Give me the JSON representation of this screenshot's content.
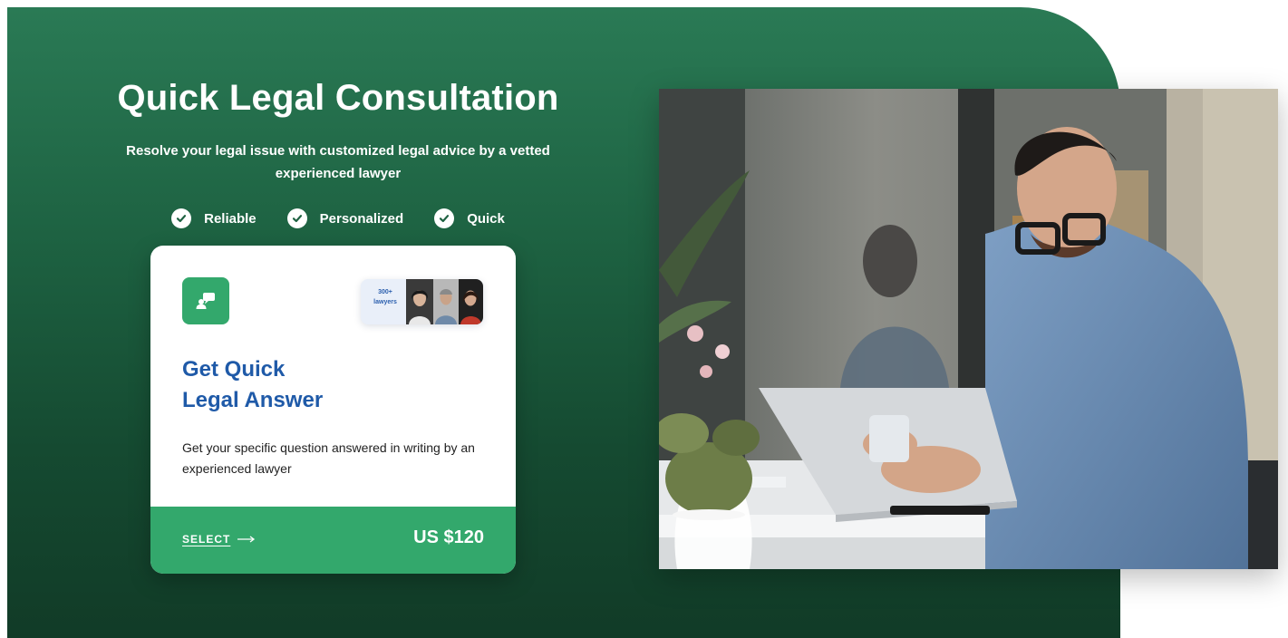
{
  "hero": {
    "title": "Quick Legal Consultation",
    "subtitle": "Resolve your legal issue with customized legal advice by a vetted experienced lawyer",
    "features": [
      "Reliable",
      "Personalized",
      "Quick"
    ]
  },
  "card": {
    "lawyers_count": "300+",
    "lawyers_label": "lawyers",
    "title_line1": "Get Quick",
    "title_line2": "Legal Answer",
    "description": "Get your specific question answered in writing by an experienced lawyer",
    "select_label": "SELECT",
    "price": "US $120"
  },
  "icons": {
    "feature": "check-circle-icon",
    "card_badge": "chat-user-icon",
    "select_arrow": "arrow-right-icon"
  },
  "colors": {
    "hero_green": "#1d6141",
    "accent_green": "#33a86c",
    "card_title_blue": "#1f5aa8",
    "white": "#ffffff"
  }
}
